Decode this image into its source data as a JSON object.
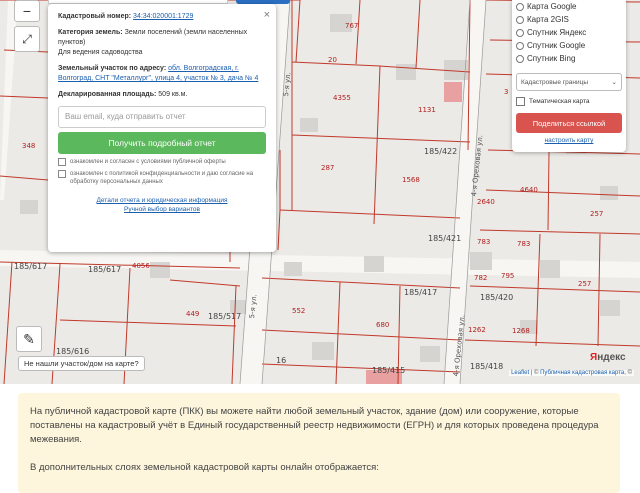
{
  "map": {
    "quarter_labels": [
      "185/617",
      "185/616",
      "185/421",
      "185/417",
      "185/422",
      "185/420",
      "185/418",
      "185/415",
      "185/517"
    ],
    "parcel_labels": [
      "767",
      "20",
      "4355",
      "1131",
      "287",
      "1568",
      "449",
      "552",
      "680",
      "16",
      "4056",
      "348",
      "2640",
      "4640",
      "257",
      "783",
      "783",
      "782",
      "795",
      "1262",
      "1268",
      "257",
      "3"
    ],
    "street_labels": [
      "5-я ул.",
      "5-я ул.",
      "4-я Ореховая ул.",
      "4-я Ореховая ул."
    ],
    "controls": {
      "minus_label": "−",
      "fullscreen_label": "⤢",
      "ruler_label": "✎"
    }
  },
  "info_popup": {
    "cad_number_label": "Кадастровый номер:",
    "cad_number_value": "34:34:020001:1729",
    "category_label": "Категория земель:",
    "category_value": "Земли поселений (земли населенных пунктов)",
    "use_value": "Для ведения садоводства",
    "address_label": "Земельный участок по адресу:",
    "address_value": "обл. Волгоградская, г. Волгоград, СНТ \"Металлург\", улица 4, участок № 3, дача № 4",
    "area_label": "Декларированная площадь:",
    "area_value": "509 кв.м.",
    "email_placeholder": "Ваш email, куда отправить отчет",
    "get_report_button": "Получить подробный отчет",
    "consent_1": "ознакомлен и согласен с условиями публичной оферты",
    "consent_2": "ознакомлен с политикой конфиденциальности и даю согласие на обработку персональных данных",
    "link_1": "Детали отчета и юридическая информация",
    "link_2": "Ручной выбор вариантов",
    "close_label": "×"
  },
  "layers_panel": {
    "options": [
      "Карта Google",
      "Карта 2GIS",
      "Спутник Яндекс",
      "Спутник Google",
      "Спутник Bing"
    ],
    "select_value": "Кадастровые границы",
    "thematic_label": "Тематическая карта",
    "share_button": "Поделиться ссылкой",
    "configure_link": "настроить карту"
  },
  "not_found_button": "Не нашли участок/дом на карте?",
  "yandex_logo": "Яндекс",
  "attribution": {
    "leaflet": "Leaflet",
    "sep": " | © ",
    "pkk": "Публичная кадастровая карта",
    "tail": ", ©"
  },
  "notice": {
    "paragraph_1": "На публичной кадастровой карте (ПКК) вы можете найти любой земельный участок, здание (дом) или сооружение, которые поставлены на кадастровый учёт в Единый государственный реестр недвижимости (ЕГРН) и для которых проведена процедура межевания.",
    "paragraph_2": "В дополнительных слоях земельной кадастровой карты онлайн отображается:"
  },
  "colors": {
    "parcel_line": "#c0392b",
    "green_button": "#5cb85c",
    "red_button": "#d9534f",
    "notice_bg": "#fdf5dc",
    "link": "#1a5fb0"
  }
}
